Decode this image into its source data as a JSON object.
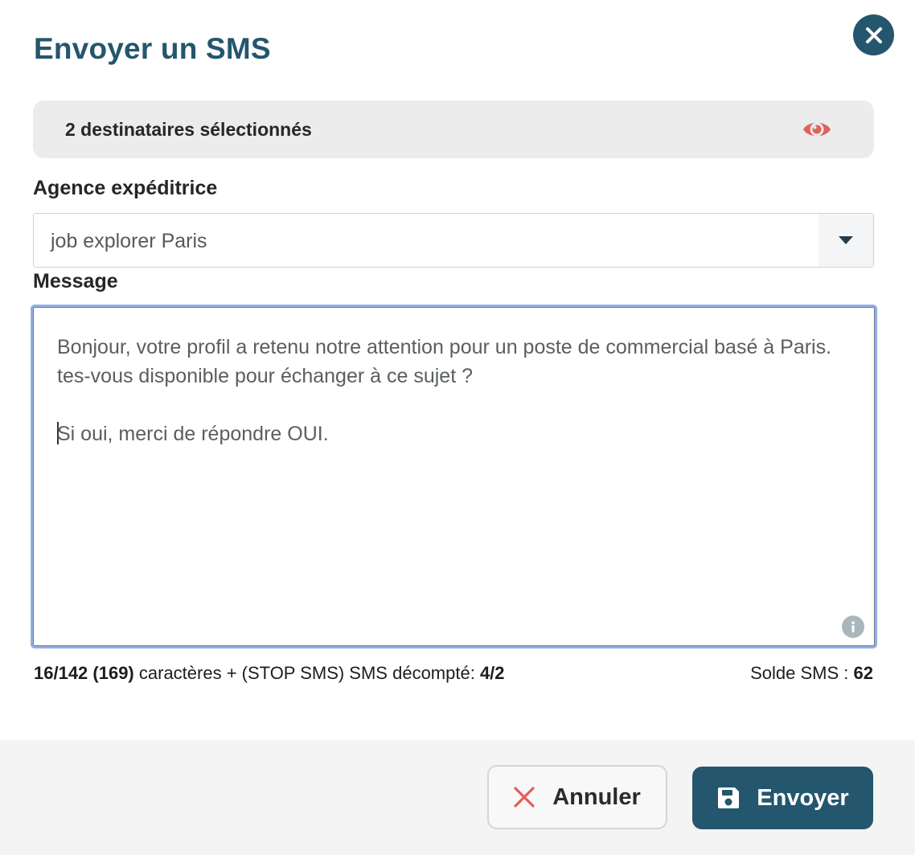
{
  "modal": {
    "title": "Envoyer un SMS"
  },
  "recipients": {
    "label": "2 destinataires sélectionnés",
    "icon": "eye-icon"
  },
  "agency": {
    "label": "Agence expéditrice",
    "selected": "job explorer Paris"
  },
  "message": {
    "label": "Message",
    "line1": "Bonjour, votre profil a retenu notre attention pour un poste de commercial basé à Paris. tes-vous disponible pour échanger à ce sujet ?",
    "line2": "Si oui, merci de répondre OUI."
  },
  "counter": {
    "chars": "16/142 (169)",
    "middle": " caractères + (STOP SMS) SMS décompté: ",
    "sms_count": "4/2"
  },
  "balance": {
    "label": "Solde SMS : ",
    "value": "62"
  },
  "footer": {
    "cancel_label": "Annuler",
    "send_label": "Envoyer"
  },
  "colors": {
    "primary": "#24566e",
    "eye": "#e0625a",
    "cancel_x": "#e35d58",
    "focus_border": "#94ade5"
  }
}
